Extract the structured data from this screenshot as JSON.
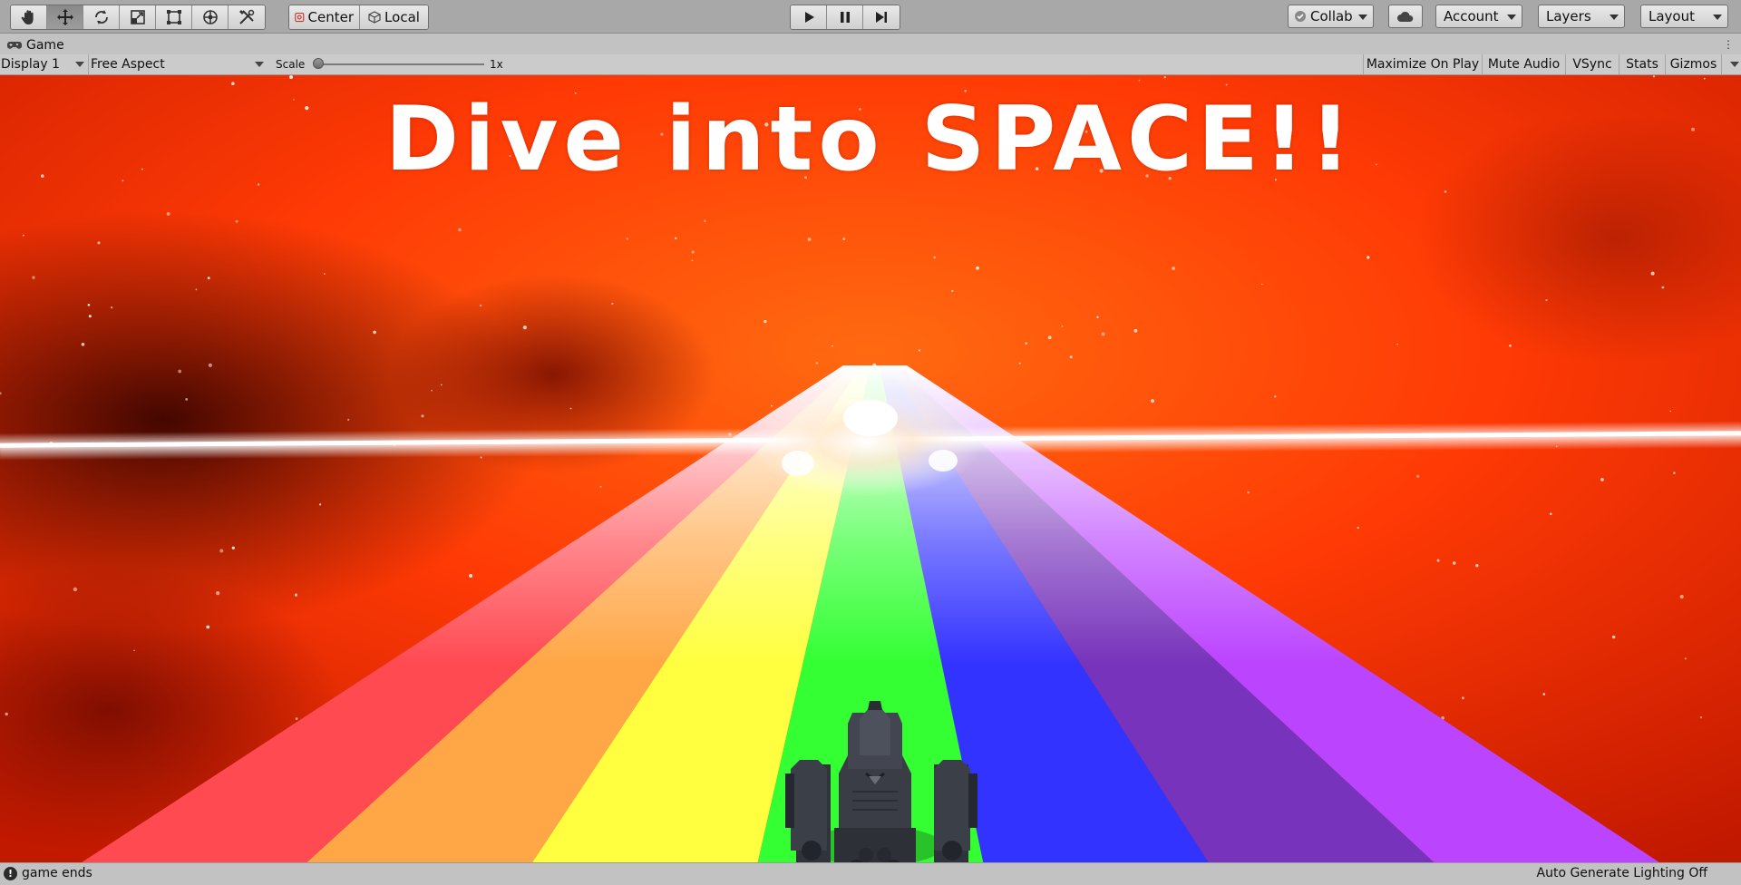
{
  "toolbar": {
    "tools": [
      {
        "icon": "hand-icon"
      },
      {
        "icon": "move-icon"
      },
      {
        "icon": "rotate-icon"
      },
      {
        "icon": "scale-icon"
      },
      {
        "icon": "rect-tool-icon"
      },
      {
        "icon": "transform-icon"
      },
      {
        "icon": "custom-tool-icon"
      }
    ],
    "pivot_mode": "Center",
    "pivot_rotation": "Local",
    "collab": "Collab",
    "account": "Account",
    "layers": "Layers",
    "layout": "Layout"
  },
  "tab": {
    "title": "Game"
  },
  "game_toolbar": {
    "display": "Display 1",
    "aspect": "Free Aspect",
    "scale_label": "Scale",
    "scale_value": "1x",
    "scale_fraction": 0.0,
    "maximize_on_play": "Maximize On Play",
    "mute_audio": "Mute Audio",
    "vsync": "VSync",
    "stats": "Stats",
    "gizmos": "Gizmos"
  },
  "game": {
    "title": "Dive into SPACE!!",
    "track_colors": [
      "#ff4a52",
      "#ffa747",
      "#ffff40",
      "#33ff33",
      "#3333ff",
      "#7733bb",
      "#bb44ff"
    ]
  },
  "status": {
    "message": "game ends",
    "right": "Auto Generate Lighting Off"
  },
  "colors": {
    "toolbar_bg": "#a8a8a8",
    "panel_bg": "#c2c2c2",
    "space_red": "#ff3300"
  }
}
